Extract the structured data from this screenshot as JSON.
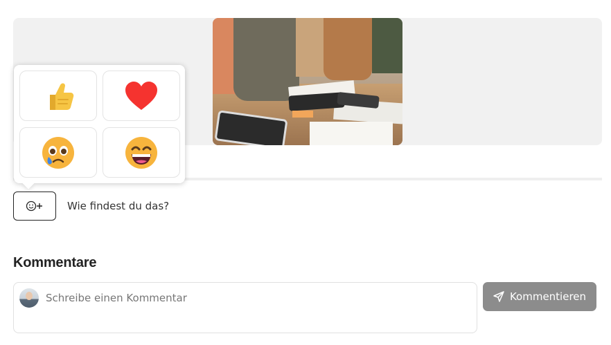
{
  "reactions": {
    "prompt": "Wie findest du das?",
    "button_icon": "smiley-plus-icon",
    "options": [
      {
        "name": "thumbs-up-icon"
      },
      {
        "name": "heart-icon"
      },
      {
        "name": "crying-face-icon"
      },
      {
        "name": "grinning-face-icon"
      }
    ]
  },
  "comments": {
    "title": "Kommentare",
    "input_placeholder": "Schreibe einen Kommentar",
    "submit_label": "Kommentieren",
    "submit_icon": "send-icon"
  },
  "colors": {
    "submit_button": "#8c8c8c",
    "heart": "#f5332f",
    "thumbs": "#f6c544"
  }
}
